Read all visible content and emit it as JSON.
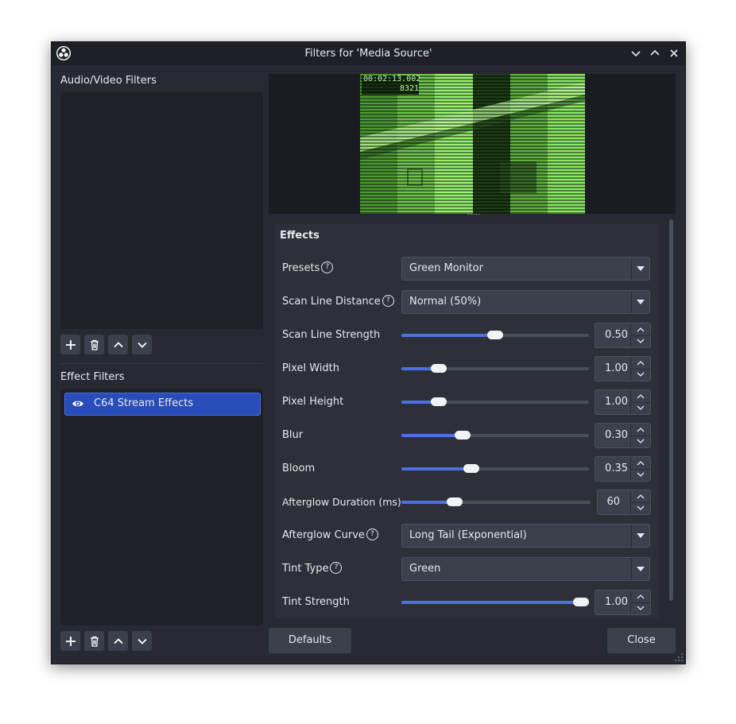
{
  "window": {
    "title": "Filters for 'Media Source'"
  },
  "audio_video_filters": {
    "label": "Audio/Video Filters",
    "items": []
  },
  "effect_filters": {
    "label": "Effect Filters",
    "items": [
      {
        "name": "C64 Stream Effects",
        "visible": true,
        "selected": true
      }
    ]
  },
  "preview": {
    "timecode": "00:02:13.002",
    "frame_counter": "8321"
  },
  "settings": {
    "section_title": "Effects",
    "presets": {
      "label": "Presets",
      "value": "Green Monitor"
    },
    "scan_line_distance": {
      "label": "Scan Line Distance",
      "value": "Normal (50%)"
    },
    "scan_line_strength": {
      "label": "Scan Line Strength",
      "value": "0.50",
      "fraction": 0.5
    },
    "pixel_width": {
      "label": "Pixel Width",
      "value": "1.00",
      "fraction": 0.17
    },
    "pixel_height": {
      "label": "Pixel Height",
      "value": "1.00",
      "fraction": 0.17
    },
    "blur": {
      "label": "Blur",
      "value": "0.30",
      "fraction": 0.31
    },
    "bloom": {
      "label": "Bloom",
      "value": "0.35",
      "fraction": 0.36
    },
    "afterglow_duration": {
      "label": "Afterglow Duration (ms)",
      "value": "60",
      "fraction": 0.26
    },
    "afterglow_curve": {
      "label": "Afterglow Curve",
      "value": "Long Tail (Exponential)"
    },
    "tint_type": {
      "label": "Tint Type",
      "value": "Green"
    },
    "tint_strength": {
      "label": "Tint Strength",
      "value": "1.00",
      "fraction": 1.0
    }
  },
  "buttons": {
    "defaults": "Defaults",
    "close": "Close"
  },
  "colors": {
    "accent": "#4c70e0",
    "selected": "#284cb8",
    "window_bg": "#272a33",
    "monitor_green": "#8af56a"
  }
}
